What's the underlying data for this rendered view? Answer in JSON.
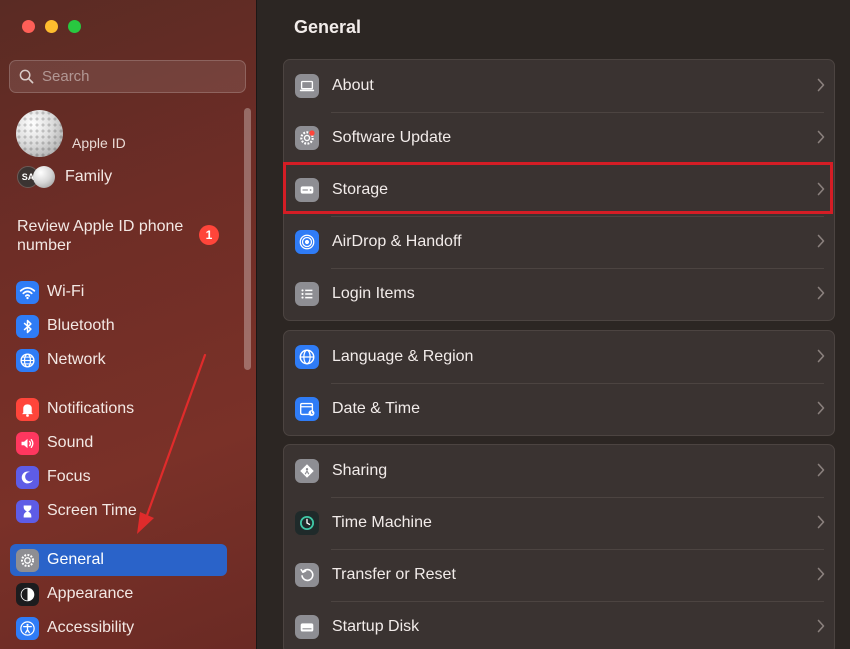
{
  "window": {
    "traffic_lights": [
      "close",
      "minimize",
      "zoom"
    ]
  },
  "sidebar": {
    "search_placeholder": "Search",
    "apple_id_label": "Apple ID",
    "family_initials": "SA",
    "family_label": "Family",
    "review_label": "Review Apple ID phone number",
    "review_badge": "1",
    "items": [
      {
        "label": "Wi-Fi",
        "icon": "wifi-icon",
        "color": "#2f7cf6"
      },
      {
        "label": "Bluetooth",
        "icon": "bluetooth-icon",
        "color": "#2f7cf6"
      },
      {
        "label": "Network",
        "icon": "globe-icon",
        "color": "#2f7cf6"
      },
      {
        "label": "Notifications",
        "icon": "bell-icon",
        "color": "#ff453a"
      },
      {
        "label": "Sound",
        "icon": "speaker-icon",
        "color": "#ff375f"
      },
      {
        "label": "Focus",
        "icon": "moon-icon",
        "color": "#5e5ce6"
      },
      {
        "label": "Screen Time",
        "icon": "hourglass-icon",
        "color": "#5e5ce6"
      },
      {
        "label": "General",
        "icon": "gear-icon",
        "color": "#8e8e93"
      },
      {
        "label": "Appearance",
        "icon": "appearance-icon",
        "color": "#1c1c1e"
      },
      {
        "label": "Accessibility",
        "icon": "accessibility-icon",
        "color": "#2f7cf6"
      }
    ],
    "active_item": "General"
  },
  "main": {
    "title": "General",
    "groups": [
      [
        {
          "label": "About",
          "icon": "laptop-icon"
        },
        {
          "label": "Software Update",
          "icon": "gear-badge-icon"
        },
        {
          "label": "Storage",
          "icon": "drive-icon"
        },
        {
          "label": "AirDrop & Handoff",
          "icon": "airdrop-icon"
        },
        {
          "label": "Login Items",
          "icon": "list-icon"
        }
      ],
      [
        {
          "label": "Language & Region",
          "icon": "globe-icon"
        },
        {
          "label": "Date & Time",
          "icon": "calendar-clock-icon"
        }
      ],
      [
        {
          "label": "Sharing",
          "icon": "sharing-icon"
        },
        {
          "label": "Time Machine",
          "icon": "time-machine-icon"
        },
        {
          "label": "Transfer or Reset",
          "icon": "reset-icon"
        },
        {
          "label": "Startup Disk",
          "icon": "disk-icon"
        }
      ]
    ],
    "highlighted_row": "Storage",
    "highlight_color": "#d41d25",
    "annotation_arrow_color": "#e02b2b"
  }
}
